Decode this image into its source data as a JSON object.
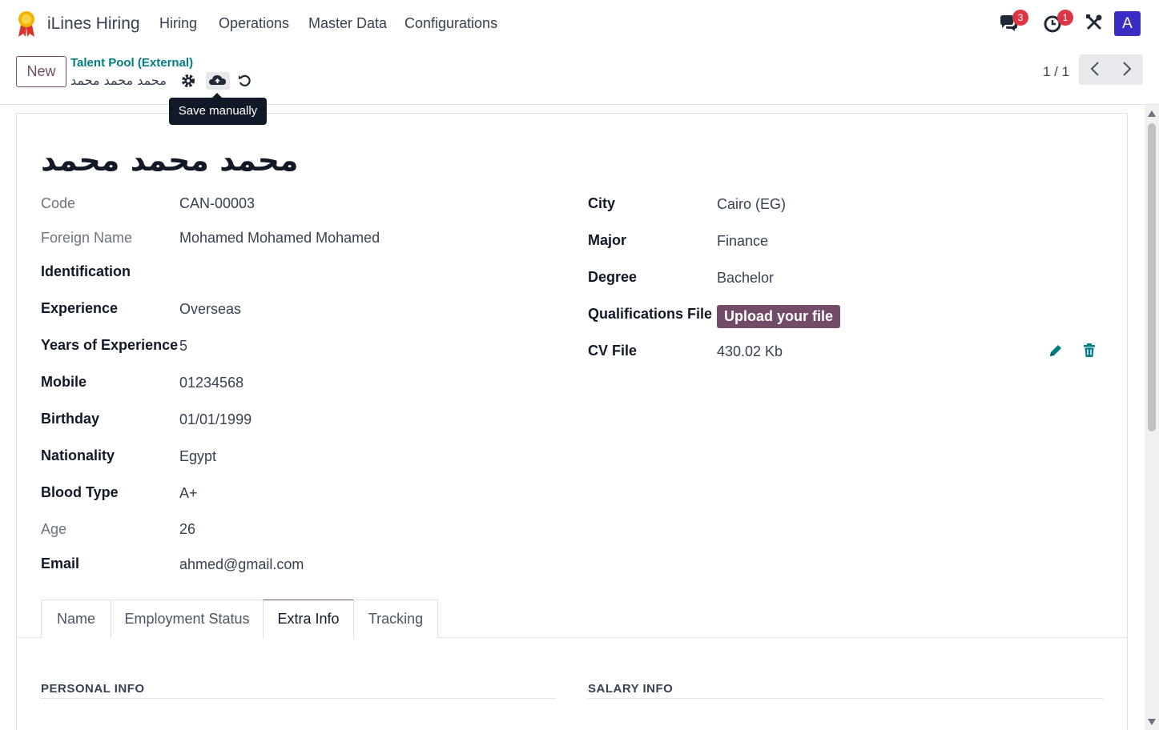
{
  "navbar": {
    "app_name": "iLines Hiring",
    "menu": [
      "Hiring",
      "Operations",
      "Master Data",
      "Configurations"
    ],
    "messages_count": "3",
    "activities_count": "1",
    "avatar_letter": "A"
  },
  "control_panel": {
    "new_label": "New",
    "breadcrumb": "Talent Pool (External)",
    "record_name": "محمد محمد محمد",
    "tooltip": "Save manually",
    "pager": "1 / 1"
  },
  "record": {
    "title": "محمد محمد محمد",
    "left_fields": [
      {
        "label": "Code",
        "value": "CAN-00003"
      },
      {
        "label": "Foreign Name",
        "value": "Mohamed Mohamed Mohamed"
      },
      {
        "label": "Identification",
        "value": ""
      },
      {
        "label": "Experience",
        "value": "Overseas"
      },
      {
        "label": "Years of Experience",
        "value": "5"
      },
      {
        "label": "Mobile",
        "value": "01234568"
      },
      {
        "label": "Birthday",
        "value": "01/01/1999"
      },
      {
        "label": "Nationality",
        "value": "Egypt"
      },
      {
        "label": "Blood Type",
        "value": "A+"
      },
      {
        "label": "Age",
        "value": "26"
      },
      {
        "label": "Email",
        "value": "ahmed@gmail.com"
      }
    ],
    "right_fields": [
      {
        "label": "City",
        "value": "Cairo (EG)"
      },
      {
        "label": "Major",
        "value": "Finance"
      },
      {
        "label": "Degree",
        "value": "Bachelor"
      },
      {
        "label": "Qualifications File",
        "value": "Upload your file"
      },
      {
        "label": "CV File",
        "value": "430.02 Kb"
      }
    ]
  },
  "tabs": [
    "Name",
    "Employment Status",
    "Extra Info",
    "Tracking"
  ],
  "sections": {
    "personal": "PERSONAL INFO",
    "salary": "SALARY INFO"
  },
  "colors": {
    "primary": "#714b67",
    "accent": "#017e84",
    "badge": "#dc3545",
    "avatar": "#3b2cc4"
  }
}
